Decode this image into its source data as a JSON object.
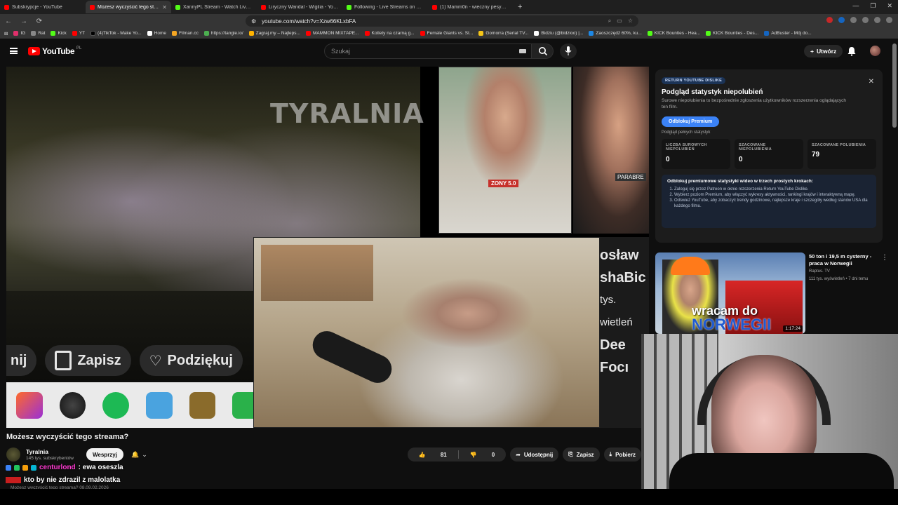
{
  "browser": {
    "tabs": [
      {
        "title": "Subskrypcje - YouTube",
        "color": "#ff0000",
        "active": false
      },
      {
        "title": "Możesz wyczyścić tego strea",
        "color": "#ff0000",
        "active": true
      },
      {
        "title": "XannyPL Stream - Watch Live on Kick",
        "color": "#53fc18",
        "active": false
      },
      {
        "title": "Liryczny Wandal - Wigilia - YouTube",
        "color": "#ff0000",
        "active": false
      },
      {
        "title": "Following - Live Streams on Kick",
        "color": "#53fc18",
        "active": false
      },
      {
        "title": "(1) Mamm0n - wieczny pesymista, ol",
        "color": "#ff0000",
        "active": false
      }
    ],
    "new_tab": "+",
    "url": "youtube.com/watch?v=Xzw66KLxbFA",
    "bookmarks": [
      {
        "label": "IG",
        "color": "#e1306c"
      },
      {
        "label": "Rat",
        "color": "#888888"
      },
      {
        "label": "Kick",
        "color": "#53fc18"
      },
      {
        "label": "YT",
        "color": "#ff0000"
      },
      {
        "label": "(4)TikTok - Make Yo...",
        "color": "#000000"
      },
      {
        "label": "Home",
        "color": "#ffffff"
      },
      {
        "label": "Filman.cc",
        "color": "#f5a623"
      },
      {
        "label": "https://tangle.io/",
        "color": "#4caf50"
      },
      {
        "label": "Zagraj.my – Najleps...",
        "color": "#ffb300"
      },
      {
        "label": "MAMMON MIXTAPE...",
        "color": "#ff0000"
      },
      {
        "label": "Kotlety na czarną g...",
        "color": "#ff0000"
      },
      {
        "label": "Female Giants vs. St...",
        "color": "#ff0000"
      },
      {
        "label": "Gomorra (Serial TV...",
        "color": "#f5c518"
      },
      {
        "label": "Bidziu (@bidzioo) |...",
        "color": "#ffffff"
      },
      {
        "label": "Zaoszczędź 60%, ku...",
        "color": "#1e88e5"
      },
      {
        "label": "KICK Bounties - Hea...",
        "color": "#53fc18"
      },
      {
        "label": "KICK Bounties - Des...",
        "color": "#53fc18"
      },
      {
        "label": "AdBuster - Mój do...",
        "color": "#1565c0"
      }
    ]
  },
  "youtube": {
    "logo_text": "YouTube",
    "logo_country": "PL",
    "search_placeholder": "Szukaj",
    "create_label": "Utwórz"
  },
  "video": {
    "overlay_title": "TYRALNIA",
    "thumb_tag_1": "ZONY 5.0",
    "thumb_tag_2": "PARABRE",
    "big_save": "Zapisz",
    "big_thanks": "Podziękuj",
    "big_cut": "nij",
    "right_strip_text": [
      "osław",
      "shaBic",
      "tys.",
      "wietleń",
      "",
      "Dee",
      "Focı"
    ],
    "title": "Możesz wyczyścić tego streama?",
    "channel_name": "Tyralnia",
    "channel_subs": "145 tys. subskrybentów",
    "subscribe_label": "Wesprzyj",
    "likes": "81",
    "dislikes": "0",
    "share_label": "Udostępnij",
    "save_label": "Zapisz",
    "download_label": "Pobierz",
    "under_text": "Możesz wyczyścić tego streama? 08.09.02.2026"
  },
  "chat": [
    {
      "user": "centurlond",
      "message": ": ewa oseszla"
    },
    {
      "user": "",
      "message": "kto by nie zdrazil z malolatka"
    }
  ],
  "ryd": {
    "tag": "RETURN YOUTUBE DISLIKE",
    "title": "Podgląd statystyk niepolubień",
    "desc": "Surowe niepolubienia to bezpośrednie zgłoszenia użytkowników rozszerzenia oglądających ten film.",
    "button": "Odblokuj Premium",
    "sub": "Podgląd pełnych statystyk",
    "stats": [
      {
        "label": "LICZBA SUROWYCH NIEPOLUBIEŃ",
        "value": "0"
      },
      {
        "label": "SZACOWANE NIEPOLUBIENIA",
        "value": "0"
      },
      {
        "label": "SZACOWANE POLUBIENIA",
        "value": "79"
      }
    ],
    "steps_heading": "Odblokuj premiumowe statystyki wideo w trzech prostych krokach:",
    "steps": [
      "Zaloguj się przez Patreon w oknie rozszerzenia Return YouTube Dislike.",
      "Wybierz poziom Premium, aby włączyć wykresy aktywności, rankingi krajów i interaktywną mapę.",
      "Odśwież YouTube, aby zobaczyć trendy godzinowe, najlepsze kraje i szczegóły według stanów USA dla każdego filmu."
    ]
  },
  "recommended": {
    "title": "50 ton i 19,5 m cysterny - praca w Norwegii",
    "channel": "Raptus. TV",
    "meta": "111 tys. wyświetleń • 7 dni temu",
    "thumb_line1": "wracam do",
    "thumb_line2": "NORWEGII",
    "duration": "1:17:24"
  }
}
